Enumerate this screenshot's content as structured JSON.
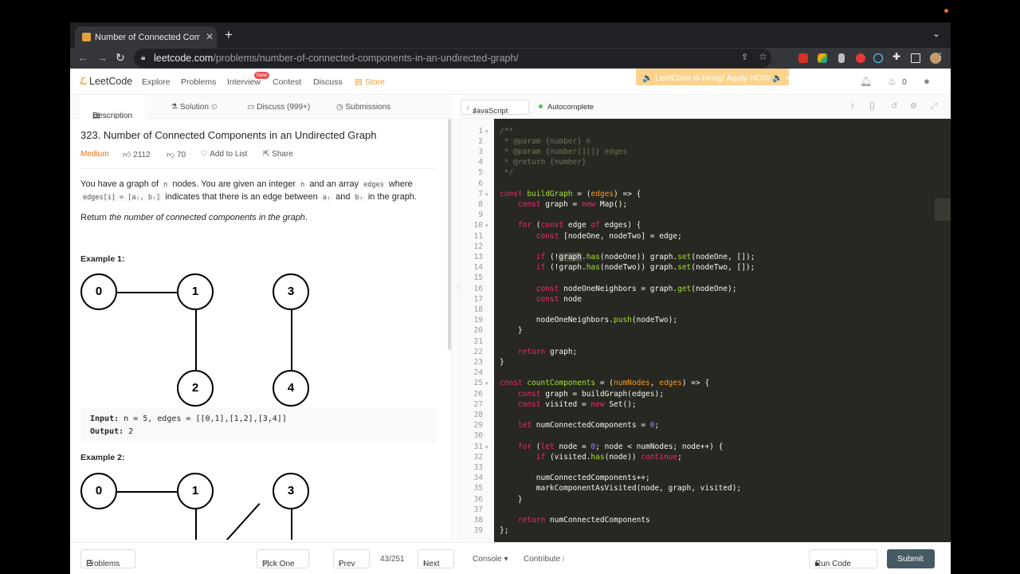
{
  "browser": {
    "tab_title": "Number of Connected Compon",
    "tab_close": "✕",
    "new_tab": "+",
    "url_domain": "leetcode.com",
    "url_path": "/problems/number-of-connected-components-in-an-undirected-graph/"
  },
  "nav": {
    "logo": "LeetCode",
    "links": [
      "Explore",
      "Problems",
      "Interview",
      "Contest",
      "Discuss",
      "Store"
    ],
    "new_badge": "New",
    "hiring": "🔈 LeetCode is hiring! Apply NOW.🔈  ×",
    "notifications": "0",
    "accent": "#f89f1b"
  },
  "subtabs": [
    "Description",
    "Solution",
    "Discuss (999+)",
    "Submissions"
  ],
  "problem": {
    "title": "323. Number of Connected Components in an Undirected Graph",
    "difficulty": "Medium",
    "likes": "2112",
    "dislikes": "70",
    "add_to_list": "Add to List",
    "share": "Share",
    "p1_a": "You have a graph of",
    "p1_n": "n",
    "p1_b": "nodes. You are given an integer",
    "p1_n2": "n",
    "p1_c": "and an array",
    "p1_edges": "edges",
    "p1_d": "where",
    "p2_edges": "edges[i] = [aᵢ, bᵢ]",
    "p2_a": "indicates that there is an edge between",
    "p2_ai": "aᵢ",
    "p2_and": "and",
    "p2_bi": "bᵢ",
    "p2_b": "in the graph.",
    "p3_a": "Return",
    "p3_b": "the number of connected components in the graph",
    "p3_c": ".",
    "example1_heading": "Example 1:",
    "example1_nodes": [
      "0",
      "1",
      "2",
      "3",
      "4"
    ],
    "example1_input_label": "Input:",
    "example1_input": " n = 5, edges = [[0,1],[1,2],[3,4]]",
    "example1_output_label": "Output:",
    "example1_output": " 2",
    "example2_heading": "Example 2:",
    "example2_nodes": [
      "0",
      "1",
      "3"
    ]
  },
  "editor": {
    "language": "JavaScript",
    "autocomplete": "Autocomplete",
    "line_numbers": [
      "1",
      "2",
      "3",
      "4",
      "5",
      "6",
      "7",
      "8",
      "9",
      "10",
      "11",
      "12",
      "13",
      "14",
      "15",
      "16",
      "17",
      "18",
      "19",
      "20",
      "21",
      "22",
      "23",
      "24",
      "25",
      "26",
      "27",
      "28",
      "29",
      "30",
      "31",
      "32",
      "33",
      "34",
      "35",
      "36",
      "37",
      "38",
      "39"
    ]
  },
  "bottom": {
    "problems": "Problems",
    "pick_one": "Pick One",
    "prev": "Prev",
    "page": "43/251",
    "next": "Next",
    "console": "Console",
    "contribute": "Contribute",
    "run_code": "Run Code",
    "submit": "Submit"
  }
}
